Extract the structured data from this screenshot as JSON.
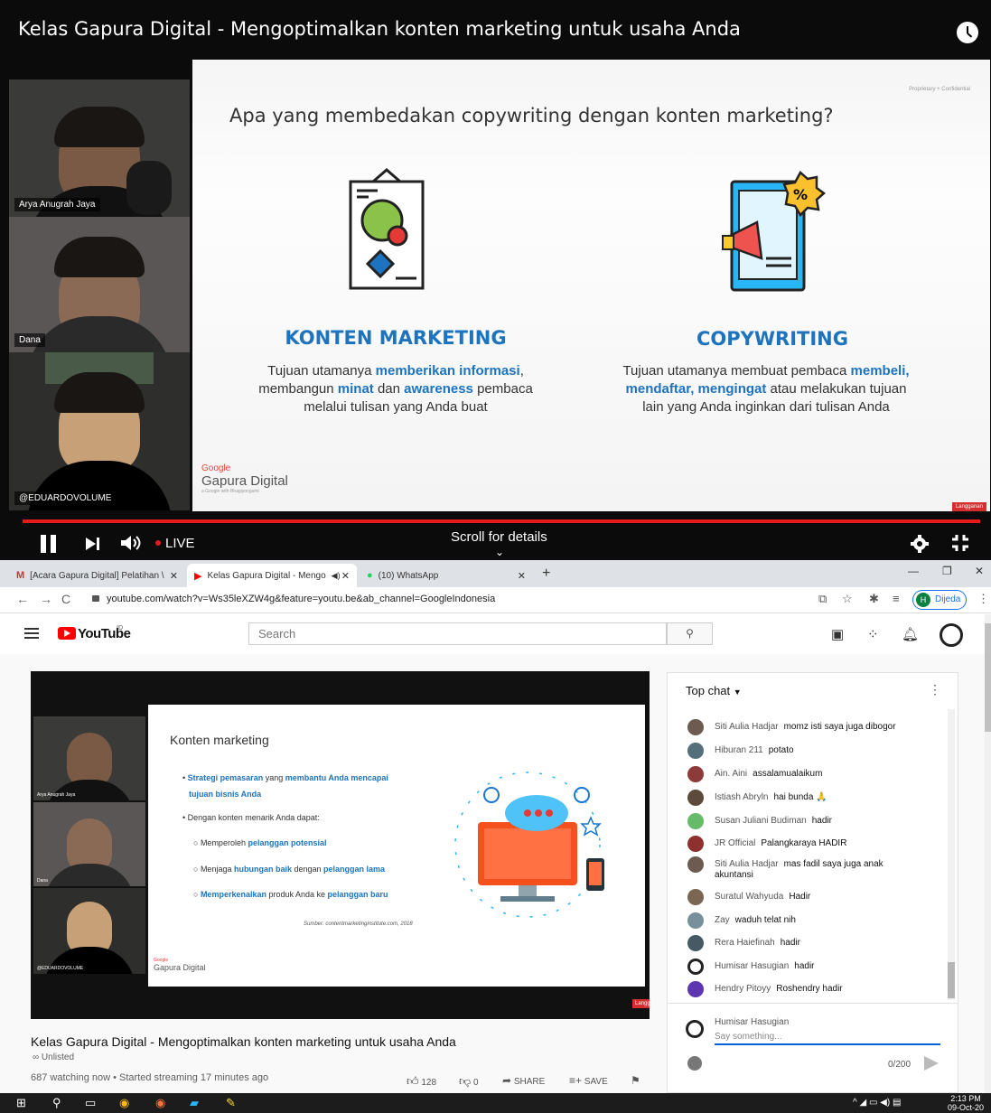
{
  "player": {
    "title": "Kelas Gapura Digital - Mengoptimalkan konten marketing untuk usaha Anda",
    "live_label": "LIVE",
    "scroll_label": "Scroll for details",
    "participants": [
      "Arya Anugrah Jaya",
      "Dana",
      "@EDUARDOVOLUME"
    ],
    "slide": {
      "question": "Apa yang membedakan copywriting dengan konten marketing?",
      "confidential": "Proprietary + Confidential",
      "left_head": "KONTEN MARKETING",
      "left_body_1a": "Tujuan utamanya ",
      "left_body_1b": "memberikan informasi",
      "left_body_1c": ",",
      "left_body_2a": "membangun ",
      "left_body_2b": "minat",
      "left_body_2c": " dan ",
      "left_body_2d": "awareness",
      "left_body_2e": " pembaca",
      "left_body_3": "melalui tulisan yang Anda buat",
      "right_head": "COPYWRITING",
      "right_body_1a": "Tujuan utamanya membuat pembaca ",
      "right_body_1b": "membeli,",
      "right_body_2a": "mendaftar, mengingat",
      "right_body_2b": " atau melakukan tujuan",
      "right_body_3": "lain yang Anda inginkan dari tulisan Anda",
      "logo_google": "Google",
      "logo_name": "Gapura Digital",
      "logo_sub": "a Google with Bhagiyongumi",
      "lang_badge": "Langganan"
    }
  },
  "tabs": [
    {
      "label": "[Acara Gapura Digital] Pelatihan \\",
      "icon": "gmail-icon"
    },
    {
      "label": "Kelas Gapura Digital - Mengo",
      "icon": "youtube-icon"
    },
    {
      "label": "(10) WhatsApp",
      "icon": "whatsapp-icon"
    }
  ],
  "address": {
    "url": "youtube.com/watch?v=Ws35leXZW4g&feature=youtu.be&ab_channel=GoogleIndonesia",
    "profile_initial": "H",
    "profile_label": "Dijeda"
  },
  "youtube": {
    "logo_text": "YouTube",
    "logo_region": "ID",
    "search_placeholder": "Search",
    "video": {
      "title": "Kelas Gapura Digital - Mengoptimalkan konten marketing untuk usaha Anda",
      "unlisted": "Unlisted",
      "meta": "687 watching now • Started streaming 17 minutes ago",
      "likes": "128",
      "dislikes": "0",
      "share": "SHARE",
      "save": "SAVE"
    },
    "mini_slide": {
      "title": "Konten marketing",
      "line1a": "Strategi pemasaran",
      "line1b": " yang ",
      "line1c": "membantu Anda mencapai",
      "line2": "tujuan bisnis Anda",
      "line3": "Dengan konten menarik Anda dapat:",
      "line4a": "Memperoleh ",
      "line4b": "pelanggan potensial",
      "line5a": "Menjaga ",
      "line5b": "hubungan baik",
      "line5c": " dengan ",
      "line5d": "pelanggan lama",
      "line6a": "Memperkenalkan",
      "line6b": " produk Anda ke ",
      "line6c": "pelanggan baru",
      "source": "Sumber: contentmarketinginstitute.com, 2018",
      "logo": "Gapura Digital",
      "logo_google": "Google",
      "lang_badge": "Langganan"
    },
    "chat": {
      "header": "Top chat",
      "messages": [
        {
          "author": "Siti Aulia Hadjar",
          "text": "momz isti saya juga dibogor"
        },
        {
          "author": "Hiburan 211",
          "text": "potato"
        },
        {
          "author": "Ain. Aini",
          "text": "assalamualaikum"
        },
        {
          "author": "Istiash Abryln",
          "text": "hai bunda 🙏"
        },
        {
          "author": "Susan Juliani Budiman",
          "text": "hadir"
        },
        {
          "author": "JR Official",
          "text": "Palangkaraya HADIR"
        },
        {
          "author": "Siti Aulia Hadjar",
          "text": "mas fadil saya juga anak akuntansi"
        },
        {
          "author": "Suratul Wahyuda",
          "text": "Hadir"
        },
        {
          "author": "Zay",
          "text": "waduh telat nih"
        },
        {
          "author": "Rera Haiefinah",
          "text": "hadir"
        },
        {
          "author": "Humisar Hasugian",
          "text": "hadir"
        },
        {
          "author": "Hendry Pitoyy",
          "text": "Roshendry hadir"
        }
      ],
      "input_name": "Humisar Hasugian",
      "input_placeholder": "Say something...",
      "count": "0/200"
    }
  },
  "taskbar": {
    "time": "2:13 PM",
    "date": "09-Oct-20"
  }
}
